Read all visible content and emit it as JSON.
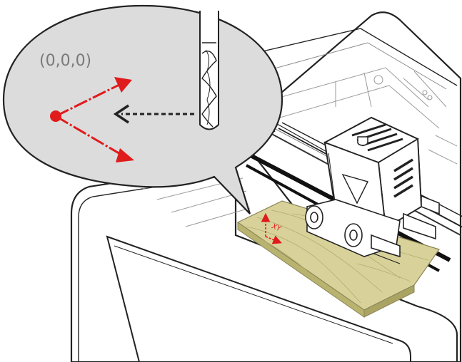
{
  "callout": {
    "origin_label": "(0,0,0)"
  },
  "workpiece": {
    "axis_label": "XY"
  },
  "colors": {
    "axis_red": "#e01b1b",
    "wood": "#d8d29a",
    "wood_dark": "#b9b370",
    "line": "#222222",
    "callout_fill": "#dcdcdc",
    "label_gray": "#7a7a7a"
  }
}
